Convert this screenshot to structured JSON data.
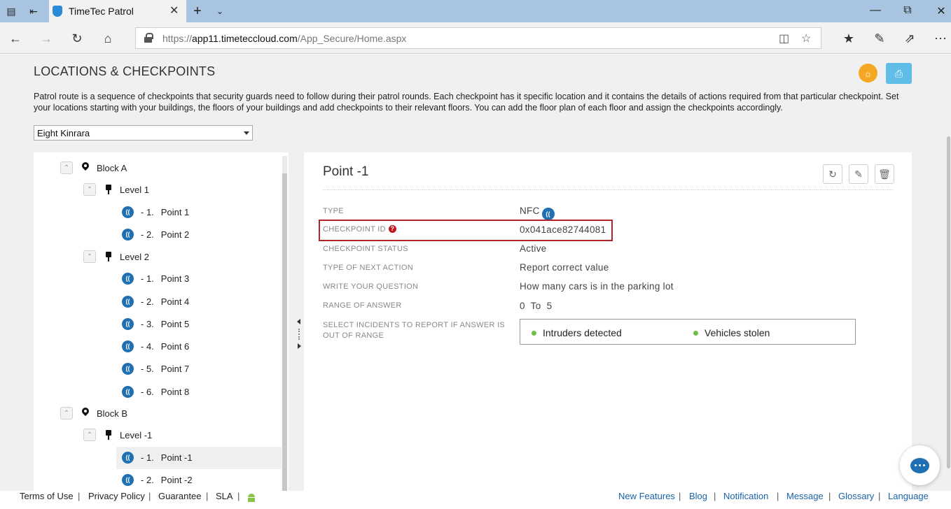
{
  "browser": {
    "tab_title": "TimeTec Patrol",
    "url_prefix": "https://",
    "url_host": "app11.timeteccloud.com",
    "url_path": "/App_Secure/Home.aspx"
  },
  "page": {
    "title": "LOCATIONS & CHECKPOINTS",
    "description": "Patrol route is a sequence of checkpoints that security guards need to follow during their patrol rounds. Each checkpoint has it specific location and it contains the details of actions required from that particular checkpoint. Set your locations starting with your buildings, the floors of your buildings and add checkpoints to their relevant floors. You can add the floor plan of each floor and assign the checkpoints accordingly.",
    "location_select": "Eight Kinrara"
  },
  "tree": {
    "block_a": "Block A",
    "level_1": "Level 1",
    "level_2": "Level 2",
    "block_b": "Block B",
    "level_m1": "Level -1",
    "points": [
      {
        "idx": "-  1.",
        "name": "Point 1"
      },
      {
        "idx": "-  2.",
        "name": "Point 2"
      },
      {
        "idx": "-  1.",
        "name": "Point 3"
      },
      {
        "idx": "-  2.",
        "name": "Point 4"
      },
      {
        "idx": "-  3.",
        "name": "Point 5"
      },
      {
        "idx": "-  4.",
        "name": "Point 6"
      },
      {
        "idx": "-  5.",
        "name": "Point 7"
      },
      {
        "idx": "-  6.",
        "name": "Point 8"
      },
      {
        "idx": "-  1.",
        "name": "Point -1"
      },
      {
        "idx": "-  2.",
        "name": "Point -2"
      }
    ]
  },
  "detail": {
    "title": "Point -1",
    "fields": {
      "type_label": "TYPE",
      "type_value": "NFC",
      "checkpoint_id_label": "CHECKPOINT ID",
      "checkpoint_id_value": "0x041ace82744081",
      "status_label": "CHECKPOINT STATUS",
      "status_value": "Active",
      "next_action_label": "TYPE OF NEXT ACTION",
      "next_action_value": "Report correct value",
      "question_label": "WRITE YOUR QUESTION",
      "question_value": "How many cars is in the parking lot",
      "range_label": "RANGE OF ANSWER",
      "range_value": "0  To  5",
      "incidents_label_1": "SELECT INCIDENTS TO REPORT IF ANSWER IS",
      "incidents_label_2": "OUT OF RANGE"
    },
    "incidents": [
      "Intruders detected",
      "Vehicles stolen"
    ]
  },
  "footer": {
    "left": [
      "Terms of Use",
      "Privacy Policy",
      "Guarantee",
      "SLA"
    ],
    "right": [
      "New Features",
      "Blog",
      "Notification",
      "Message",
      "Glossary",
      "Language"
    ]
  },
  "colors": {
    "accent_blue": "#1f6fb3",
    "highlight_red": "#b3232a",
    "incident_dot": "#6cc04a",
    "bulb_orange": "#f5a623",
    "print_blue": "#5fbde8"
  }
}
